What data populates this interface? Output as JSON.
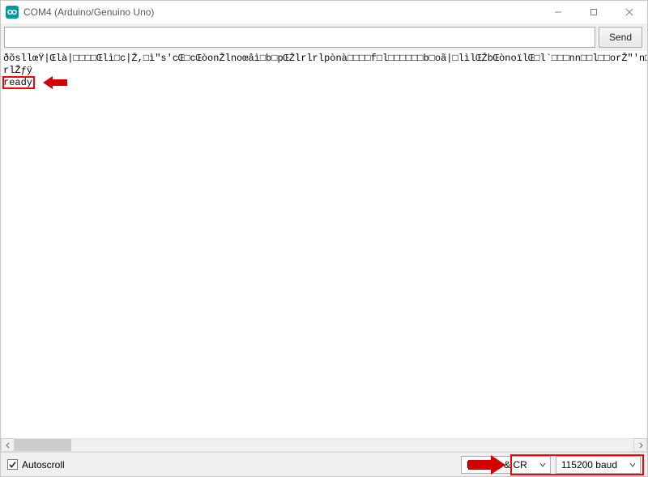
{
  "titlebar": {
    "title": "COM4 (Arduino/Genuino Uno)"
  },
  "input_row": {
    "serial_value": "",
    "serial_placeholder": "",
    "send_label": "Send"
  },
  "output": {
    "line1": "ðõsllœŸ|Œlà|□□□□Œlì□c|Ž,□ì\"s'cŒ□cŒòonŽlnoœâì□b□pŒŽlrlrlpònà□□□□f□l□□□□□□b□oã|□lìlŒŽbŒònoïlŒ□l`□□□nn□□l□□orŽ\"'n□□",
    "line2": "rlŽƒÿ",
    "line3": "ready"
  },
  "bottom": {
    "autoscroll_label": "Autoscroll",
    "autoscroll_checked": true,
    "line_ending_value": "Both NL & CR",
    "baud_value": "115200 baud"
  },
  "icons": {
    "app": "arduino-logo-icon",
    "minimize": "minimize-icon",
    "maximize": "maximize-icon",
    "close": "close-icon",
    "chevron_down": "chevron-down-icon",
    "chevron_left": "chevron-left-icon",
    "chevron_right": "chevron-right-icon",
    "checkmark": "checkmark-icon"
  },
  "annotations": {
    "ready_box": "red-highlight",
    "dropdown_box": "red-highlight"
  }
}
